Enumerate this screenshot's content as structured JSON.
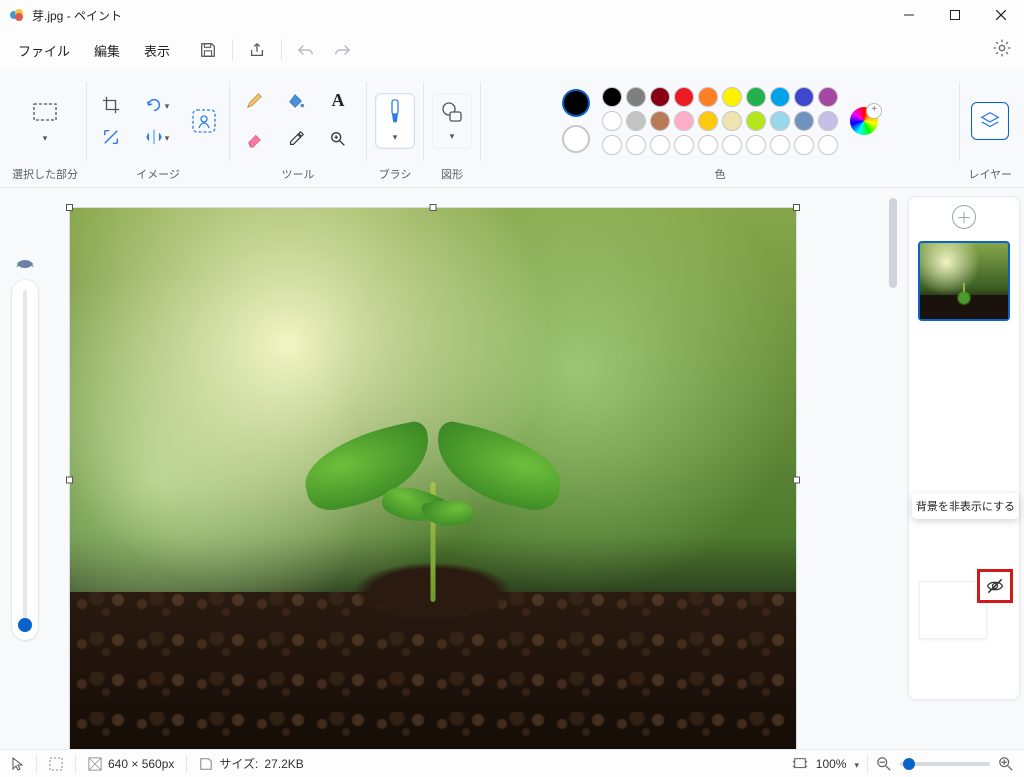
{
  "window": {
    "title": "芽.jpg - ペイント"
  },
  "menu": {
    "file": "ファイル",
    "edit": "編集",
    "view": "表示"
  },
  "ribbon": {
    "selection": "選択した部分",
    "image": "イメージ",
    "tools": "ツール",
    "brush": "ブラシ",
    "shapes": "図形",
    "colors": "色",
    "layers": "レイヤー"
  },
  "palette": {
    "primary": "#000000",
    "secondary": "#ffffff",
    "row1": [
      "#000000",
      "#7f7f7f",
      "#880015",
      "#ed1c24",
      "#ff7f27",
      "#fff200",
      "#22b14c",
      "#00a2e8",
      "#3f48cc",
      "#a349a4"
    ],
    "row2": [
      "#ffffff",
      "#c3c3c3",
      "#b97a57",
      "#ffaec9",
      "#ffc90e",
      "#efe4b0",
      "#b5e61d",
      "#99d9ea",
      "#7092be",
      "#c8bfe7"
    ],
    "row3": [
      "",
      "",
      "",
      "",
      "",
      "",
      "",
      "",
      "",
      ""
    ]
  },
  "layers_panel": {
    "tooltip": "背景を非表示にする"
  },
  "status": {
    "dimensions": "640 × 560px",
    "size_label": "サイズ:",
    "size_value": "27.2KB",
    "zoom": "100%"
  }
}
